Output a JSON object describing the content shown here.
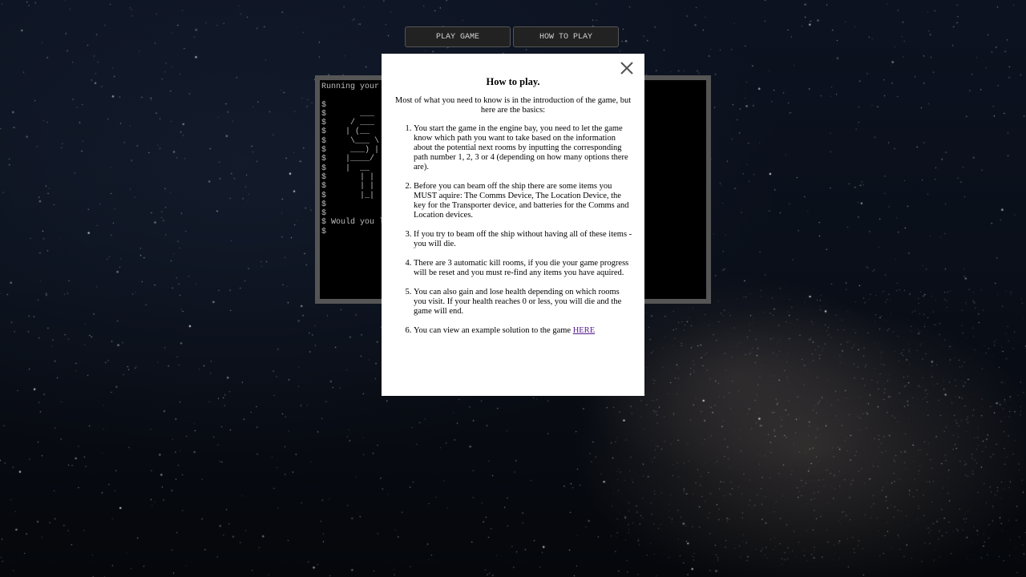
{
  "nav": {
    "play_label": "PLAY GAME",
    "howto_label": "HOW TO PLAY"
  },
  "terminal": {
    "lines": [
      "Running your",
      "",
      "$",
      "$       ___",
      "$     / ___",
      "$    | (__",
      "$     \\___ \\",
      "$     ___) |",
      "$    |____/",
      "$    |  __",
      "$       | |",
      "$       | |",
      "$       |_|",
      "$",
      "$",
      "$ Would you l",
      "$"
    ]
  },
  "modal": {
    "close_icon": "close-icon",
    "title": "How to play.",
    "intro": "Most of what you need to know is in the introduction of the game, but here are the basics:",
    "items": [
      "You start the game in the engine bay, you need to let the game know which path you want to take based on the information about the potential next rooms by inputting the corresponding path number 1, 2, 3 or 4 (depending on how many options there are).",
      "Before you can beam off the ship there are some items you MUST aquire: The Comms Device, The Location Device, the key for the Transporter device, and batteries for the Comms and Location devices.",
      "If you try to beam off the ship without having all of these items - you will die.",
      "There are 3 automatic kill rooms, if you die your game progress will be reset and you must re-find any items you have aquired.",
      "You can also gain and lose health depending on which rooms you visit. If your health reaches 0 or less, you will die and the game will end."
    ],
    "last_item_text": "You can view an example solution to the game ",
    "link_label": "HERE"
  },
  "colors": {
    "link": "#551a8b",
    "terminal_text": "#bdbdbd",
    "terminal_frame": "#555555"
  }
}
